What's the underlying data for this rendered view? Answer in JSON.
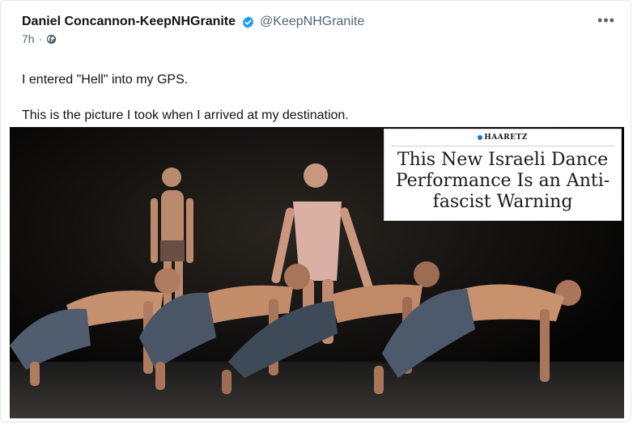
{
  "author": {
    "name": "Daniel Concannon-KeepNHGranite",
    "handle": "@KeepNHGranite",
    "verified_icon": "verified-badge-icon"
  },
  "meta": {
    "time": "7h",
    "separator": "·",
    "audience_icon": "globe-icon"
  },
  "menu": {
    "more_label": "•••"
  },
  "post": {
    "line1": "I entered \"Hell\" into my GPS.",
    "line2": "This is the picture I took when I arrived at my destination."
  },
  "media": {
    "source": "HAARETZ",
    "headline": "This New Israeli Dance Performance Is an Anti-fascist Warning"
  },
  "colors": {
    "text": "#0f1419",
    "muted": "#536471",
    "verified": "#1d9bf0"
  }
}
